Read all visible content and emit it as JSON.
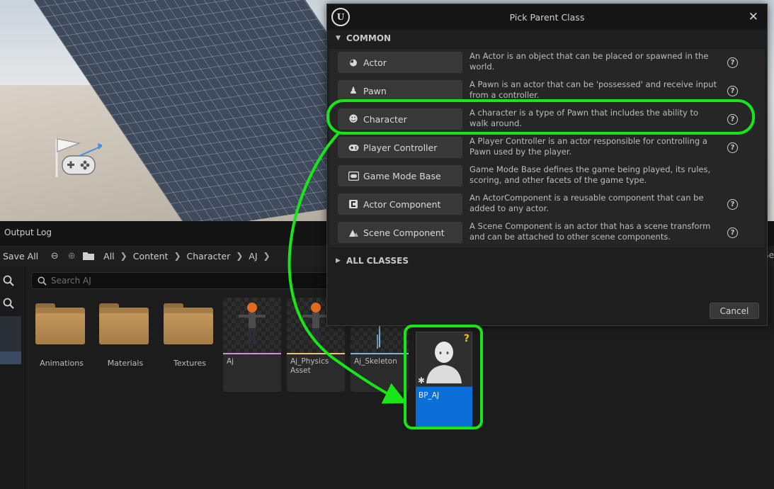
{
  "dialog": {
    "title": "Pick Parent Class",
    "common_header": "COMMON",
    "all_classes_header": "ALL CLASSES",
    "cancel_label": "Cancel",
    "classes": [
      {
        "label": "Actor",
        "icon": "actor-icon",
        "description": "An Actor is an object that can be placed or spawned in the world.",
        "has_help": true
      },
      {
        "label": "Pawn",
        "icon": "pawn-icon",
        "description": "A Pawn is an actor that can be 'possessed' and receive input from a controller.",
        "has_help": true
      },
      {
        "label": "Character",
        "icon": "character-icon",
        "description": "A character is a type of Pawn that includes the ability to walk around.",
        "has_help": true
      },
      {
        "label": "Player Controller",
        "icon": "gamepad-icon",
        "description": "A Player Controller is an actor responsible for controlling a Pawn used by the player.",
        "has_help": true
      },
      {
        "label": "Game Mode Base",
        "icon": "game-mode-icon",
        "description": "Game Mode Base defines the game being played, its rules, scoring, and other facets of the game type.",
        "has_help": false
      },
      {
        "label": "Actor Component",
        "icon": "actor-component-icon",
        "description": "An ActorComponent is a reusable component that can be added to any actor.",
        "has_help": true
      },
      {
        "label": "Scene Component",
        "icon": "scene-component-icon",
        "description": "A Scene Component is an actor that has a scene transform and can be attached to other scene components.",
        "has_help": true
      }
    ]
  },
  "browser": {
    "tab_label": "Output Log",
    "save_all_label": "Save All",
    "path": [
      "All",
      "Content",
      "Character",
      "AJ"
    ],
    "path_overflow": "Se",
    "search_placeholder": "Search AJ",
    "folders": [
      {
        "label": "Animations"
      },
      {
        "label": "Materials"
      },
      {
        "label": "Textures"
      }
    ],
    "assets": [
      {
        "label": "Aj",
        "strip_color": "#d68ad8"
      },
      {
        "label": "Aj_Physics Asset",
        "strip_color": "#e8c27a"
      },
      {
        "label": "Aj_Skeleton",
        "strip_color": "#7fb3d6"
      }
    ],
    "new_blueprint": {
      "label": "BP_AJ",
      "badge": "?",
      "color": "#0a70d8"
    }
  },
  "annotation": {
    "highlight_color": "#19e619"
  }
}
